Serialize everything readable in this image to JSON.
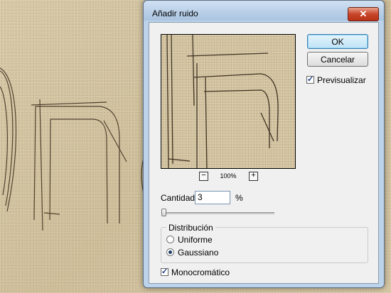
{
  "dialog": {
    "title": "Añadir ruido",
    "close_glyph": "✕",
    "preview_zoom": "100%",
    "zoom_out_glyph": "−",
    "zoom_in_glyph": "+",
    "ok_label": "OK",
    "cancel_label": "Cancelar",
    "preview_label": "Previsualizar",
    "preview_checked": true,
    "amount_label": "Cantidad:",
    "amount_value": "3",
    "amount_unit": "%",
    "amount_slider_fraction": 0.03,
    "distribution": {
      "title": "Distribución",
      "options": [
        "Uniforme",
        "Gaussiano"
      ],
      "selected": "Gaussiano"
    },
    "monochromatic_label": "Monocromático",
    "monochromatic_checked": true
  },
  "colors": {
    "title_bar": "#bcd3ea",
    "close_button": "#c8452a",
    "ok_highlight": "#bfe3f7",
    "sand": "#d6c7a4"
  }
}
